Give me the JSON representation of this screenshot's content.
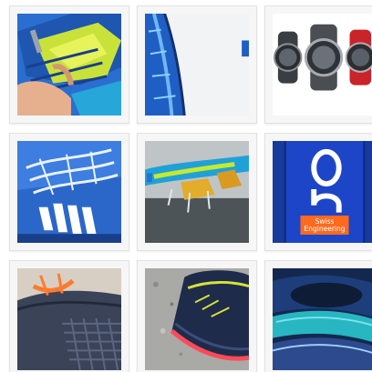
{
  "gallery": {
    "tiles": [
      {
        "id": "tile-1",
        "subject": "blue and yellow running shoe upper being laced by a hand"
      },
      {
        "id": "tile-2",
        "subject": "close-up of blue running shoe upper edge"
      },
      {
        "id": "tile-3",
        "subject": "three sports watches: black, silver and red"
      },
      {
        "id": "tile-4",
        "subject": "blue running shoe with white laces and white stripes"
      },
      {
        "id": "tile-5",
        "subject": "running shoe sole splashing in water"
      },
      {
        "id": "tile-6",
        "subject": "blue shoe tongue with On logo letters",
        "label_lines": [
          "Swiss",
          "Engineering"
        ]
      },
      {
        "id": "tile-7",
        "subject": "trail shoe with orange laces and mesh toe"
      },
      {
        "id": "tile-8",
        "subject": "navy trail shoe with yellow and pink accents on gravel"
      },
      {
        "id": "tile-9",
        "subject": "teal and blue running shoe close-up"
      }
    ]
  },
  "colors": {
    "tile_border": "#e2e2e2",
    "tile_background": "#f6f6f6",
    "accent_orange": "#ff6a1f",
    "shoe_blue": "#1f5fc4"
  }
}
